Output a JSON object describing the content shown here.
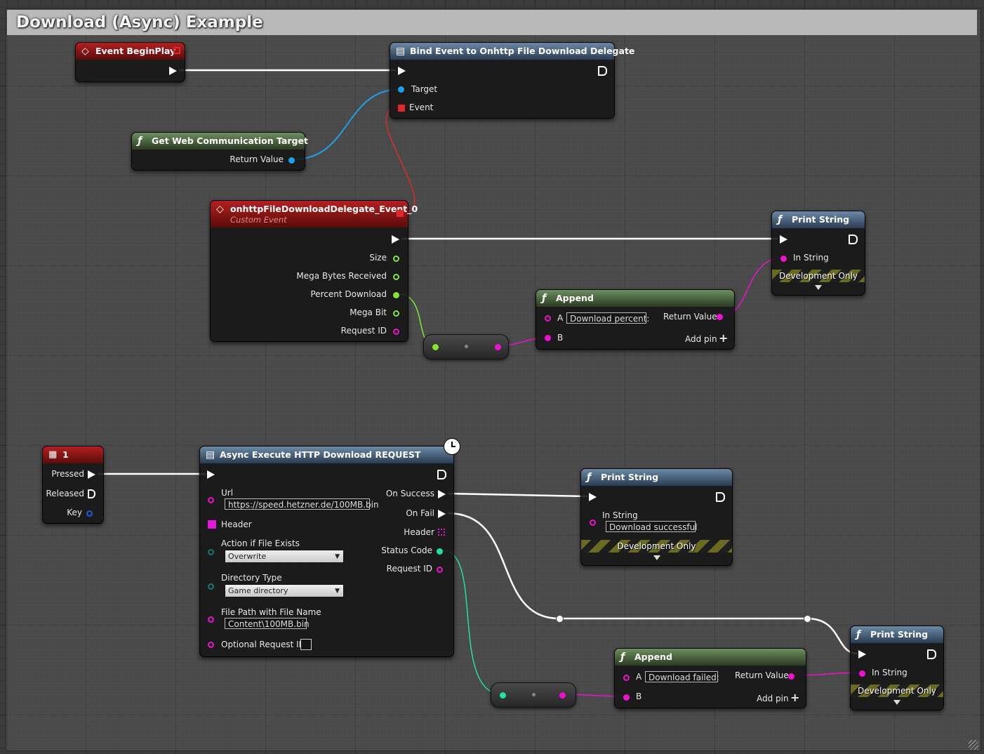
{
  "comment": {
    "title": "Download (Async) Example"
  },
  "nodes": {
    "begin_play": {
      "title": "Event BeginPlay"
    },
    "bind_event": {
      "title": "Bind Event to Onhttp File Download Delegate",
      "pins": {
        "target": "Target",
        "event": "Event"
      }
    },
    "get_target": {
      "title": "Get Web Communication Target",
      "pins": {
        "return_value": "Return Value"
      }
    },
    "custom_event": {
      "title": "onhttpFileDownloadDelegate_Event_0",
      "subtitle": "Custom Event",
      "pins": {
        "size": "Size",
        "mb_received": "Mega Bytes Received",
        "percent": "Percent Download",
        "mega_bit": "Mega Bit",
        "request_id": "Request ID"
      }
    },
    "append_top": {
      "title": "Append",
      "a_label": "A",
      "a_value": "Download percent:",
      "b_label": "B",
      "return_value": "Return Value",
      "add_pin": "Add pin"
    },
    "print_top": {
      "title": "Print String",
      "in_string": "In String",
      "dev_only": "Development Only"
    },
    "key_1": {
      "title": "1",
      "pins": {
        "pressed": "Pressed",
        "released": "Released",
        "key": "Key"
      }
    },
    "async_exec": {
      "title": "Async Execute HTTP Download REQUEST",
      "url_label": "Url",
      "url_value": "https://speed.hetzner.de/100MB.bin",
      "header_label": "Header",
      "action_label": "Action if File Exists",
      "action_value": "Overwrite",
      "dir_label": "Directory Type",
      "dir_value": "Game directory",
      "path_label": "File Path with File Name",
      "path_value": "Content\\100MB.bin",
      "optional_label": "Optional Request ID",
      "on_success": "On Success",
      "on_fail": "On Fail",
      "header_out": "Header",
      "status_code": "Status Code",
      "request_id": "Request ID"
    },
    "print_success": {
      "title": "Print String",
      "in_string": "In String",
      "value": "Download successful",
      "dev_only": "Development Only"
    },
    "append_bottom": {
      "title": "Append",
      "a_label": "A",
      "a_value": "Download failed:",
      "b_label": "B",
      "return_value": "Return Value",
      "add_pin": "Add pin"
    },
    "print_fail": {
      "title": "Print String",
      "in_string": "In String",
      "dev_only": "Development Only"
    }
  },
  "colors": {
    "exec": "#ffffff",
    "object": "#1ea0e8",
    "delegate": "#e02a2a",
    "string": "#f010d0",
    "int": "#7ee830",
    "int_outline": "#8fe04a",
    "teal": "#20e0a8",
    "struct": "#e01ad8"
  }
}
